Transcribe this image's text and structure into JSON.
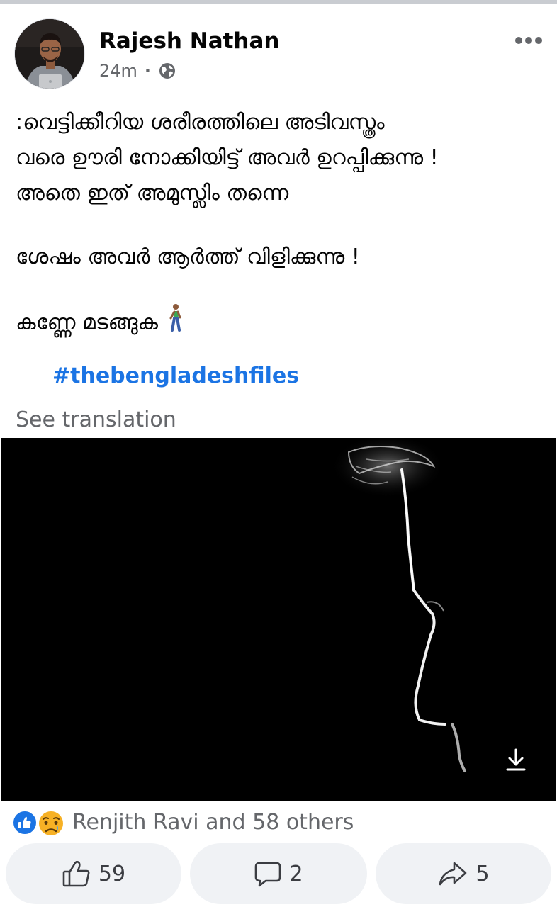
{
  "post": {
    "author": "Rajesh Nathan",
    "time": "24m",
    "separator": "·",
    "text_lines": [
      ":വെട്ടിക്കീറിയ ശരീരത്തിലെ അടിവസ്ത്രം",
      "വരെ ഊരി നോക്കിയിട്ട് അവർ ഉറപ്പിക്കുന്നു !",
      "അതെ ഇത് അമുസ്ലിം തന്നെ",
      "ശേഷം അവർ ആർത്ത് വിളിക്കുന്നു !",
      "കണ്ണേ മടങ്ങുക"
    ],
    "hashtag": "#thebengladeshfiles",
    "see_translation": "See translation"
  },
  "icons": {
    "audience": "globe-icon",
    "more": "more-options-icon",
    "download": "download-icon",
    "emoji": "person-walking-emoji",
    "reaction_1": "like-reaction-icon",
    "reaction_2": "sad-reaction-icon",
    "like": "thumbs-up-icon",
    "comment": "comment-bubble-icon",
    "share": "share-arrow-icon"
  },
  "reactions": {
    "summary": "Renjith Ravi and 58 others"
  },
  "actions": {
    "like_count": "59",
    "comment_count": "2",
    "share_count": "5"
  },
  "colors": {
    "link": "#1b74e4",
    "secondary_text": "#65676b",
    "button_bg": "#f0f2f5",
    "like_blue": "#1b74e4",
    "sad_yellow": "#f7b125"
  }
}
